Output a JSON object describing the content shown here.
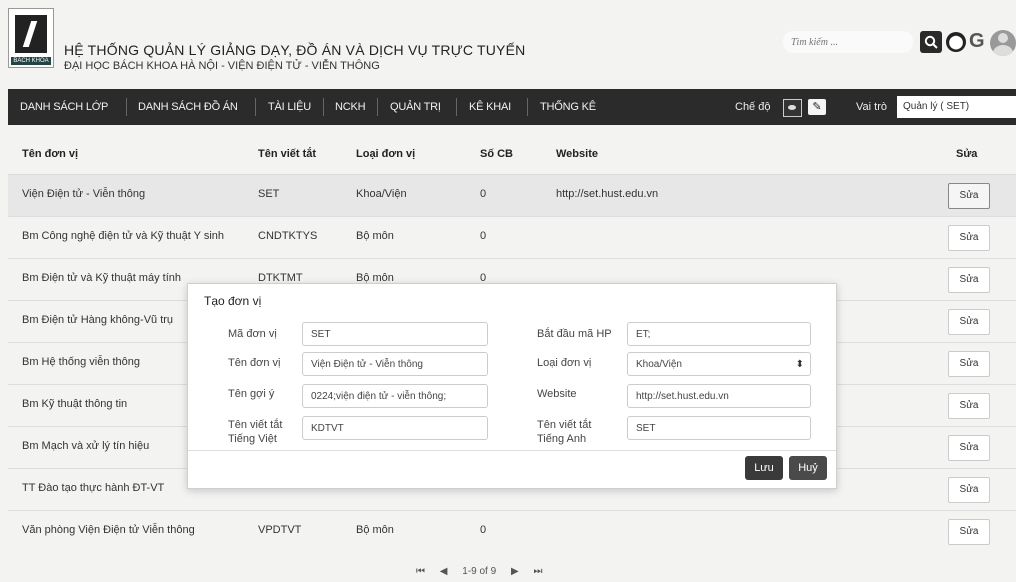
{
  "header": {
    "logo_caption": "BÁCH KHOA",
    "title": "HỆ THỐNG QUẢN LÝ GIẢNG DẠY, ĐỒ ÁN VÀ DỊCH VỤ TRỰC TUYẾN",
    "subtitle": "ĐẠI HỌC BÁCH KHOA HÀ NỘI - VIỆN ĐIỆN TỬ - VIỄN THÔNG",
    "search_placeholder": "Tìm kiếm ..."
  },
  "nav": {
    "items": [
      "DANH SÁCH LỚP",
      "DANH SÁCH ĐỒ ÁN",
      "TÀI LIỆU",
      "NCKH",
      "QUẢN TRỊ",
      "KÊ KHAI",
      "THỐNG KÊ"
    ],
    "mode_label": "Chế độ",
    "role_label": "Vai trò",
    "role_value": "Quản lý ( SET)"
  },
  "table": {
    "headers": [
      "Tên đơn vị",
      "Tên viết tắt",
      "Loại đơn vị",
      "Số CB",
      "Website",
      "Sửa"
    ],
    "edit_label": "Sửa",
    "rows": [
      {
        "name": "Viện Điện tử - Viễn thông",
        "abbr": "SET",
        "type": "Khoa/Viện",
        "count": "0",
        "website": "http://set.hust.edu.vn"
      },
      {
        "name": "Bm Công nghệ điện tử và Kỹ thuật Y sinh",
        "abbr": "CNDTKTYS",
        "type": "Bộ môn",
        "count": "0",
        "website": ""
      },
      {
        "name": "Bm Điện tử và Kỹ thuật máy tính",
        "abbr": "DTKTMT",
        "type": "Bộ môn",
        "count": "0",
        "website": ""
      },
      {
        "name": "Bm Điện tử Hàng không-Vũ trụ",
        "abbr": "",
        "type": "",
        "count": "",
        "website": ""
      },
      {
        "name": "Bm Hệ thống viễn thông",
        "abbr": "",
        "type": "",
        "count": "",
        "website": ""
      },
      {
        "name": "Bm Kỹ thuật thông tin",
        "abbr": "",
        "type": "",
        "count": "",
        "website": ""
      },
      {
        "name": "Bm Mạch và xử lý tín hiệu",
        "abbr": "",
        "type": "",
        "count": "",
        "website": ""
      },
      {
        "name": "TT Đào tạo thực hành ĐT-VT",
        "abbr": "",
        "type": "",
        "count": "",
        "website": ""
      },
      {
        "name": "Văn phòng Viện Điện tử Viễn thông",
        "abbr": "VPDTVT",
        "type": "Bộ môn",
        "count": "0",
        "website": ""
      }
    ]
  },
  "modal": {
    "title": "Tạo đơn vị",
    "fields": {
      "code_label": "Mã đơn vị",
      "code_value": "SET",
      "name_label": "Tên đơn vị",
      "name_value": "Viện Điện tử - Viễn thông",
      "alias_label": "Tên gợi ý",
      "alias_value": "0224;viện điện tử - viễn thông;",
      "abbr_vn_label": "Tên viết tắt Tiếng Việt",
      "abbr_vn_value": "KDTVT",
      "hp_label": "Bắt đầu mã HP",
      "hp_value": "ET;",
      "type_label": "Loại đơn vị",
      "type_value": "Khoa/Viện",
      "website_label": "Website",
      "website_value": "http://set.hust.edu.vn",
      "abbr_en_label": "Tên viết tắt Tiếng Anh",
      "abbr_en_value": "SET"
    },
    "save_label": "Lưu",
    "cancel_label": "Huỷ"
  },
  "pager": {
    "text": "1-9 of 9"
  }
}
